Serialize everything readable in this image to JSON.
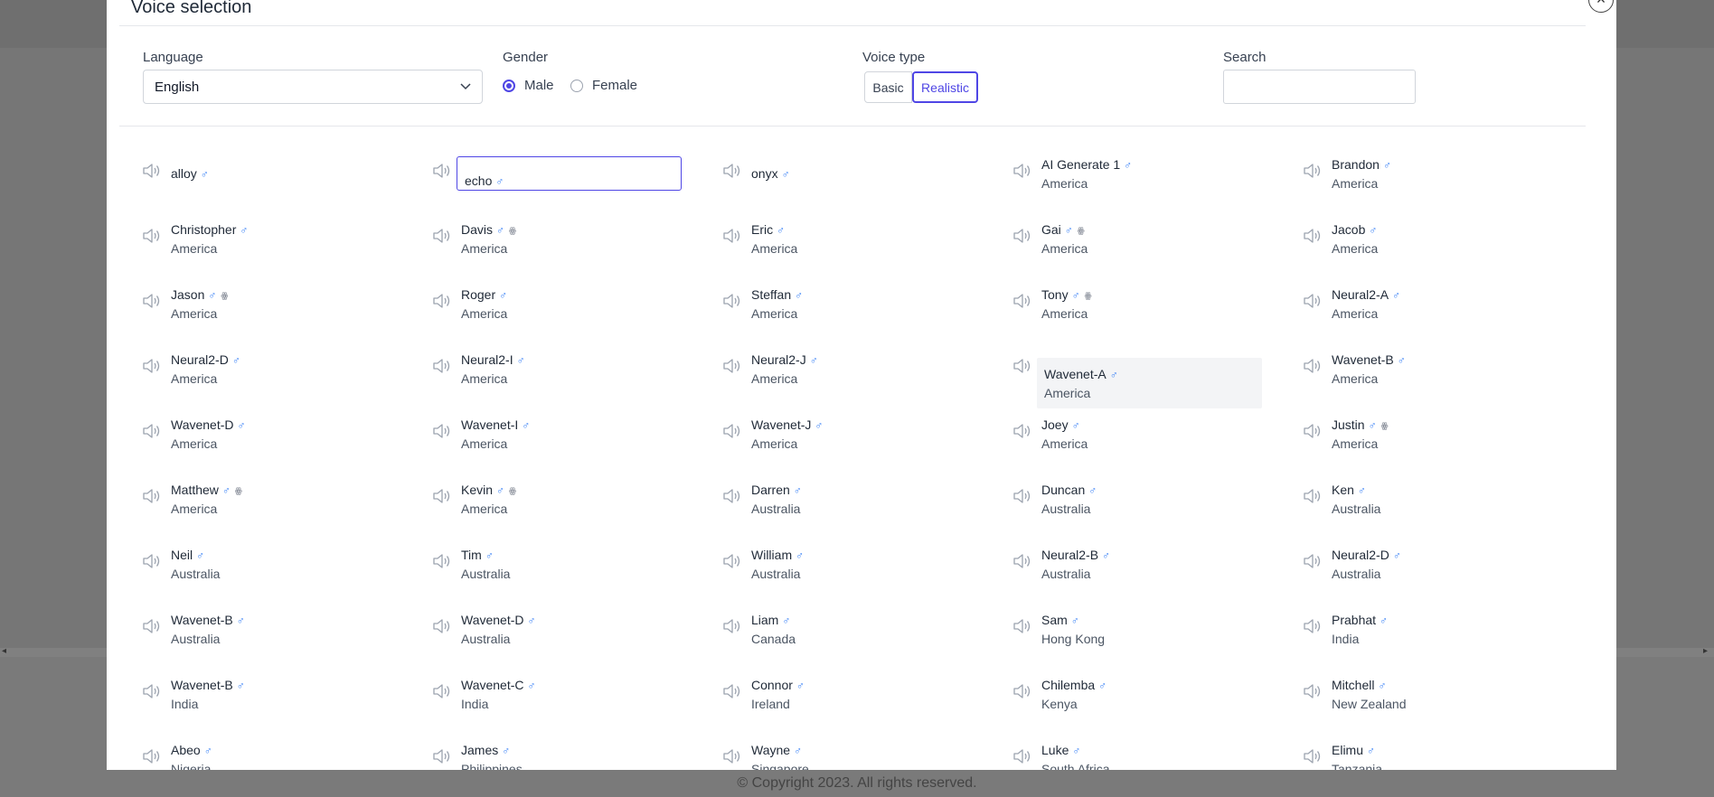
{
  "modal": {
    "title": "Voice selection",
    "close_glyph": "×"
  },
  "filters": {
    "language_label": "Language",
    "language_value": "English",
    "gender_label": "Gender",
    "gender_options": [
      "Male",
      "Female"
    ],
    "gender_selected": "Male",
    "voice_type_label": "Voice type",
    "voice_type_options": [
      "Basic",
      "Realistic"
    ],
    "voice_type_selected": "Realistic",
    "search_label": "Search",
    "search_value": ""
  },
  "gender_symbol": "♂",
  "badge_symbol": "ꙮ",
  "voices": [
    [
      {
        "name": "alloy",
        "location": ""
      },
      {
        "name": "echo",
        "location": "",
        "state": "focused"
      },
      {
        "name": "onyx",
        "location": ""
      },
      {
        "name": "AI Generate 1",
        "location": "America"
      },
      {
        "name": "Brandon",
        "location": "America"
      }
    ],
    [
      {
        "name": "Christopher",
        "location": "America"
      },
      {
        "name": "Davis",
        "location": "America",
        "badge": true
      },
      {
        "name": "Eric",
        "location": "America"
      },
      {
        "name": "Gai",
        "location": "America",
        "badge": true
      },
      {
        "name": "Jacob",
        "location": "America"
      }
    ],
    [
      {
        "name": "Jason",
        "location": "America",
        "badge": true
      },
      {
        "name": "Roger",
        "location": "America"
      },
      {
        "name": "Steffan",
        "location": "America"
      },
      {
        "name": "Tony",
        "location": "America",
        "badge": true
      },
      {
        "name": "Neural2-A",
        "location": "America"
      }
    ],
    [
      {
        "name": "Neural2-D",
        "location": "America"
      },
      {
        "name": "Neural2-I",
        "location": "America"
      },
      {
        "name": "Neural2-J",
        "location": "America"
      },
      {
        "name": "Wavenet-A",
        "location": "America",
        "state": "hover"
      },
      {
        "name": "Wavenet-B",
        "location": "America"
      }
    ],
    [
      {
        "name": "Wavenet-D",
        "location": "America"
      },
      {
        "name": "Wavenet-I",
        "location": "America"
      },
      {
        "name": "Wavenet-J",
        "location": "America"
      },
      {
        "name": "Joey",
        "location": "America"
      },
      {
        "name": "Justin",
        "location": "America",
        "badge": true
      }
    ],
    [
      {
        "name": "Matthew",
        "location": "America",
        "badge": true
      },
      {
        "name": "Kevin",
        "location": "America",
        "badge": true
      },
      {
        "name": "Darren",
        "location": "Australia"
      },
      {
        "name": "Duncan",
        "location": "Australia"
      },
      {
        "name": "Ken",
        "location": "Australia"
      }
    ],
    [
      {
        "name": "Neil",
        "location": "Australia"
      },
      {
        "name": "Tim",
        "location": "Australia"
      },
      {
        "name": "William",
        "location": "Australia"
      },
      {
        "name": "Neural2-B",
        "location": "Australia"
      },
      {
        "name": "Neural2-D",
        "location": "Australia"
      }
    ],
    [
      {
        "name": "Wavenet-B",
        "location": "Australia"
      },
      {
        "name": "Wavenet-D",
        "location": "Australia"
      },
      {
        "name": "Liam",
        "location": "Canada"
      },
      {
        "name": "Sam",
        "location": "Hong Kong"
      },
      {
        "name": "Prabhat",
        "location": "India"
      }
    ],
    [
      {
        "name": "Wavenet-B",
        "location": "India"
      },
      {
        "name": "Wavenet-C",
        "location": "India"
      },
      {
        "name": "Connor",
        "location": "Ireland"
      },
      {
        "name": "Chilemba",
        "location": "Kenya"
      },
      {
        "name": "Mitchell",
        "location": "New Zealand"
      }
    ],
    [
      {
        "name": "Abeo",
        "location": "Nigeria"
      },
      {
        "name": "James",
        "location": "Philippines"
      },
      {
        "name": "Wayne",
        "location": "Singapore"
      },
      {
        "name": "Luke",
        "location": "South Africa"
      },
      {
        "name": "Elimu",
        "location": "Tanzania"
      }
    ]
  ],
  "footer": "© Copyright 2023. All rights reserved.",
  "colors": {
    "accent": "#4f46e5",
    "gender_icon": "#3b82f6",
    "backdrop": "#767676"
  }
}
